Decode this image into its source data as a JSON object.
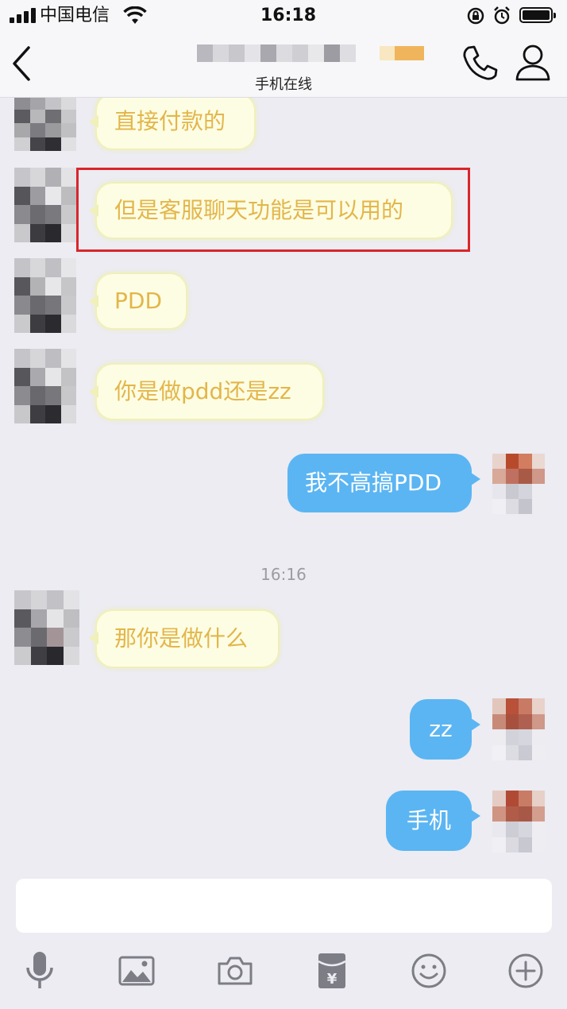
{
  "status_bar": {
    "carrier": "中国电信",
    "time": "16:18"
  },
  "nav": {
    "subtitle": "手机在线",
    "back_icon": "chevron-left-icon",
    "call_icon": "phone-icon",
    "profile_icon": "person-icon"
  },
  "messages": [
    {
      "direction": "in",
      "text": "直接付款的"
    },
    {
      "direction": "in",
      "text": "但是客服聊天功能是可以用的",
      "highlighted": true
    },
    {
      "direction": "in",
      "text": "PDD"
    },
    {
      "direction": "in",
      "text": "你是做pdd还是zz"
    },
    {
      "direction": "out",
      "text": "我不高搞PDD"
    },
    {
      "direction": "in",
      "text": "那你是做什么"
    },
    {
      "direction": "out",
      "text": "zz"
    },
    {
      "direction": "out",
      "text": "手机"
    }
  ],
  "timestamp": "16:16",
  "toolbar": [
    "mic-icon",
    "image-icon",
    "camera-icon",
    "red-packet-icon",
    "emoji-icon",
    "plus-icon"
  ],
  "colors": {
    "incoming_text": "#e3b64a",
    "incoming_bubble": "#fdfde4",
    "outgoing_bubble": "#5bb5f2",
    "highlight_box": "#d9262b",
    "background": "#ececf2"
  }
}
